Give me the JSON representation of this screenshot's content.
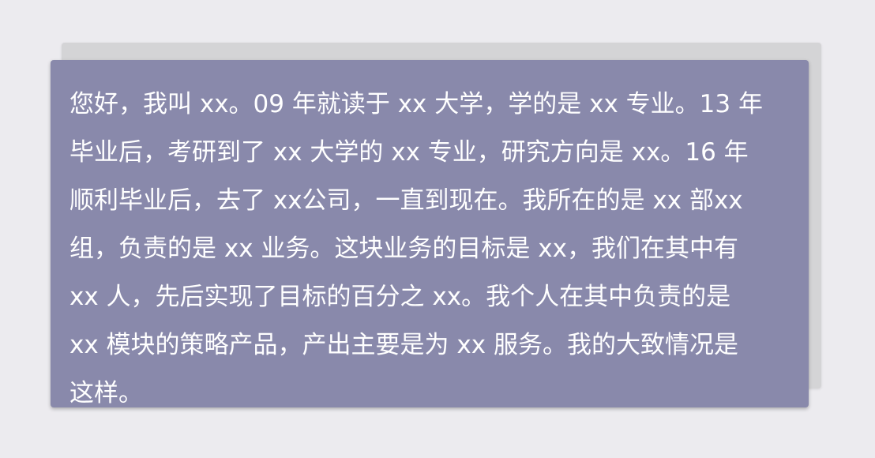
{
  "card": {
    "lines": [
      "您好，我叫 xx。09 年就读于 xx 大学，学的是 xx 专业。13 年",
      "毕业后，考研到了 xx 大学的 xx 专业，研究方向是 xx。16 年",
      "顺利毕业后，去了 xx公司，一直到现在。我所在的是 xx 部xx",
      "组，负责的是 xx 业务。这块业务的目标是 xx，我们在其中有",
      "xx 人，先后实现了目标的百分之 xx。我个人在其中负责的是",
      "xx 模块的策略产品，产出主要是为 xx 服务。我的大致情况是",
      "这样。"
    ]
  },
  "colors": {
    "page_background": "#ecebef",
    "card_background": "#8989ab",
    "back_card_background": "#d4d4d6",
    "text": "#ffffff"
  }
}
